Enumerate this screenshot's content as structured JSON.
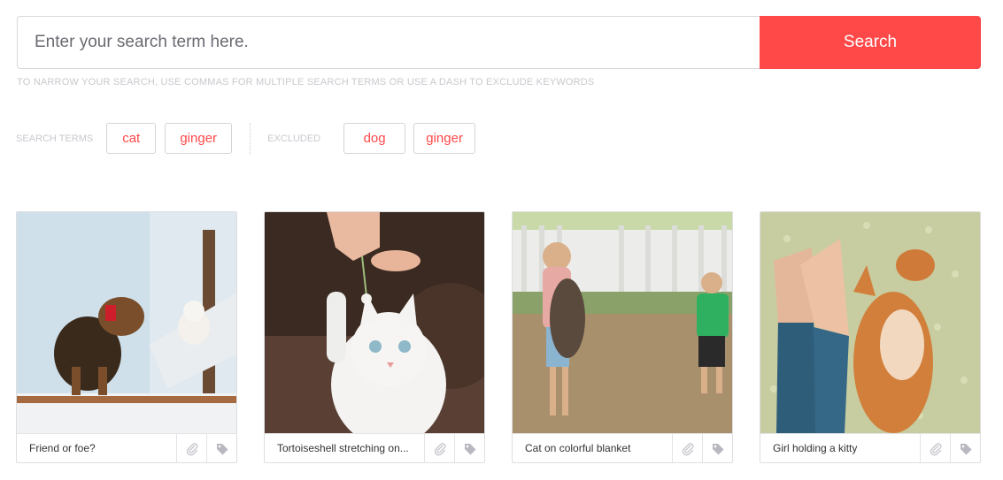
{
  "search": {
    "placeholder": "Enter your search term here.",
    "button_label": "Search",
    "hint": "TO NARROW YOUR SEARCH, USE COMMAS FOR MULTIPLE SEARCH TERMS OR USE A DASH TO EXCLUDE KEYWORDS"
  },
  "filters": {
    "search_terms_label": "SEARCH TERMS",
    "search_terms": [
      "cat",
      "ginger"
    ],
    "excluded_label": "EXCLUDED",
    "excluded_terms": [
      "dog",
      "ginger"
    ]
  },
  "results": [
    {
      "caption": "Friend or foe?",
      "icons": [
        "paperclip-icon",
        "tag-icon"
      ]
    },
    {
      "caption": "Tortoiseshell stretching on...",
      "icons": [
        "paperclip-icon",
        "tag-icon"
      ]
    },
    {
      "caption": "Cat on colorful blanket",
      "icons": [
        "paperclip-icon",
        "tag-icon"
      ]
    },
    {
      "caption": "Girl holding a kitty",
      "icons": [
        "paperclip-icon",
        "tag-icon"
      ]
    }
  ],
  "colors": {
    "accent": "#ff4848",
    "muted_text": "#c9c9cf",
    "border": "#d9d9de"
  }
}
